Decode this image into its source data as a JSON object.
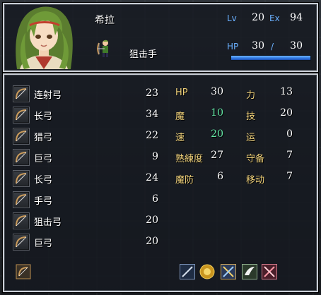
{
  "unit": {
    "name": "希拉",
    "class": "狙击手",
    "lv_label": "Lv",
    "lv": "20",
    "ex_label": "Ex",
    "ex": "94",
    "hp_label": "HP",
    "hp_current": "30",
    "hp_slash": "/",
    "hp_max": "30",
    "hp_fraction": 1.0
  },
  "weapons": [
    {
      "name": "连射弓",
      "uses": "23"
    },
    {
      "name": "长弓",
      "uses": "34"
    },
    {
      "name": "猎弓",
      "uses": "22"
    },
    {
      "name": "巨弓",
      "uses": "9"
    },
    {
      "name": "长弓",
      "uses": "24"
    },
    {
      "name": "手弓",
      "uses": "6"
    },
    {
      "name": "狙击弓",
      "uses": "20"
    },
    {
      "name": "巨弓",
      "uses": "20"
    }
  ],
  "stats": {
    "hp": {
      "label": "HP",
      "value": "30"
    },
    "str": {
      "label": "力",
      "value": "13"
    },
    "mag": {
      "label": "魔",
      "value": "10"
    },
    "skl": {
      "label": "技",
      "value": "20"
    },
    "spd": {
      "label": "速",
      "value": "20"
    },
    "lck": {
      "label": "运",
      "value": "0"
    },
    "wlv": {
      "label": "熟練度",
      "value": "27"
    },
    "def": {
      "label": "守备",
      "value": "7"
    },
    "res": {
      "label": "魔防",
      "value": "6"
    },
    "mov": {
      "label": "移动",
      "value": "7"
    }
  },
  "colors": {
    "label_blue": "#6ab0ff",
    "stat_gold": "#f1d27a",
    "stat_green": "#63e6a4",
    "hp_bar": "#2f76e0"
  },
  "icons": {
    "class": "archer-icon",
    "weapon": "bow-icon",
    "bag": "item-bag-icon",
    "skills": [
      "sword-skill-icon",
      "sun-medallion-icon",
      "crossed-swords-icon",
      "wing-icon",
      "crossed-arrows-icon"
    ]
  }
}
